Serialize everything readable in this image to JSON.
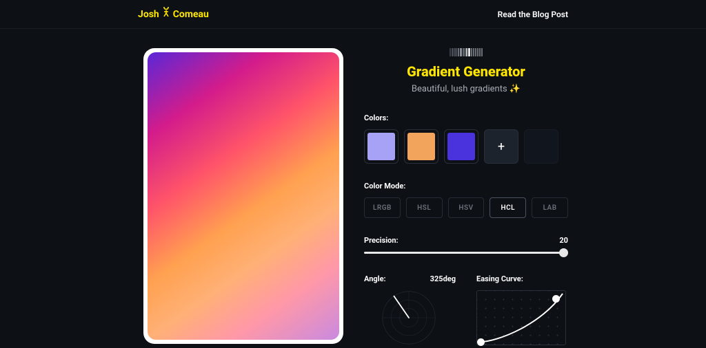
{
  "header": {
    "logo_first": "Josh",
    "logo_last": "Comeau",
    "blog_link": "Read the Blog Post"
  },
  "app": {
    "title": "Gradient Generator",
    "subtitle_text": "Beautiful, lush gradients",
    "subtitle_emoji": "✨"
  },
  "colors": {
    "label": "Colors:",
    "swatches": [
      "#a8a2f7",
      "#f2a45c",
      "#4a33dd"
    ],
    "add_icon": "+"
  },
  "color_mode": {
    "label": "Color Mode:",
    "options": [
      "LRGB",
      "HSL",
      "HSV",
      "HCL",
      "LAB"
    ],
    "active": "HCL"
  },
  "precision": {
    "label": "Precision:",
    "value": "20"
  },
  "angle": {
    "label": "Angle:",
    "value": "325deg"
  },
  "easing": {
    "label": "Easing Curve:"
  }
}
